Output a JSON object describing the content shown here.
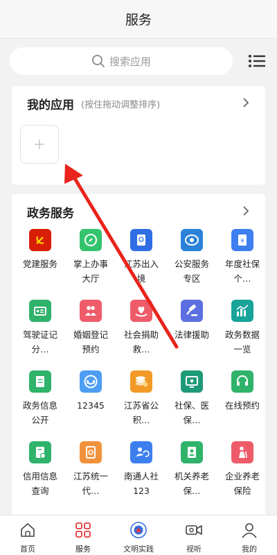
{
  "header": {
    "title": "服务"
  },
  "search": {
    "placeholder": "搜索应用"
  },
  "my_apps": {
    "title": "我的应用",
    "hint": "(按住拖动调整排序)"
  },
  "gov": {
    "title": "政务服务",
    "apps": [
      {
        "label": "党建服务",
        "icon": "party-flag-icon",
        "color": "#d81e06"
      },
      {
        "label": "掌上办事大厅",
        "icon": "compass-icon",
        "color": "#35c46e"
      },
      {
        "label": "江苏出入境",
        "icon": "passport-icon",
        "color": "#2f6ee5"
      },
      {
        "label": "公安服务专区",
        "icon": "police-badge-icon",
        "color": "#2b82d9"
      },
      {
        "label": "年度社保个…",
        "icon": "yuan-doc-icon",
        "color": "#3e7ff0"
      },
      {
        "label": "驾驶证记分…",
        "icon": "license-card-icon",
        "color": "#2fb36a"
      },
      {
        "label": "婚姻登记预约",
        "icon": "couple-icon",
        "color": "#ee5c6a"
      },
      {
        "label": "社会捐助救…",
        "icon": "heart-hands-icon",
        "color": "#ee5c6a"
      },
      {
        "label": "法律援助",
        "icon": "gavel-icon",
        "color": "#5c6fe0"
      },
      {
        "label": "政务数据一览",
        "icon": "bar-chart-icon",
        "color": "#18a39a"
      },
      {
        "label": "政务信息公开",
        "icon": "info-doc-icon",
        "color": "#2fb36a"
      },
      {
        "label": "12345",
        "icon": "hotline-icon",
        "color": "#4d9df2"
      },
      {
        "label": "江苏省公积…",
        "icon": "coins-icon",
        "color": "#f29a27"
      },
      {
        "label": "社保、医保…",
        "icon": "monitor-heart-icon",
        "color": "#1f9a78"
      },
      {
        "label": "在线预约",
        "icon": "headset-icon",
        "color": "#2fb36a"
      },
      {
        "label": "信用信息查询",
        "icon": "credit-doc-icon",
        "color": "#2fb36a"
      },
      {
        "label": "江苏统一代…",
        "icon": "search-doc-icon",
        "color": "#f0923c"
      },
      {
        "label": "南通人社123",
        "icon": "people-refresh-icon",
        "color": "#3e7ff0"
      },
      {
        "label": "机关养老保…",
        "icon": "doc-person-icon",
        "color": "#2fb36a"
      },
      {
        "label": "企业养老保险",
        "icon": "elder-person-icon",
        "color": "#ee5c6a"
      }
    ]
  },
  "tabs": [
    {
      "label": "首页",
      "icon": "home-icon"
    },
    {
      "label": "服务",
      "icon": "grid-icon",
      "color": "#e23a3a"
    },
    {
      "label": "文明实践",
      "icon": "emblem-icon"
    },
    {
      "label": "视听",
      "icon": "video-icon"
    },
    {
      "label": "我的",
      "icon": "user-icon"
    }
  ],
  "colors": {
    "arrow": "#e8241c",
    "accent": "#e23a3a"
  }
}
